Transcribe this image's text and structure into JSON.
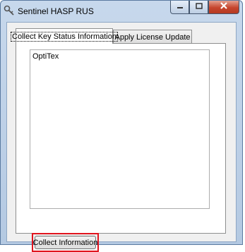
{
  "window": {
    "title": "Sentinel HASP RUS"
  },
  "tabs": [
    {
      "label": "Collect Key Status Information",
      "active": true
    },
    {
      "label": "Apply License Update",
      "active": false
    }
  ],
  "status_box": {
    "text": "OptiTex"
  },
  "collect_button": {
    "label": "Collect Information"
  },
  "colors": {
    "highlight": "#e0141e",
    "close_button": "#c6452d"
  },
  "icons": [
    "app-key-icon",
    "minimize-icon",
    "maximize-icon",
    "close-icon"
  ]
}
